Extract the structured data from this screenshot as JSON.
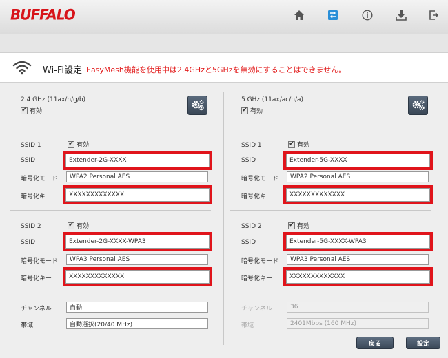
{
  "brand": {
    "logo": "BUFFALO",
    "color": "#d7141a"
  },
  "nav": {
    "icons": [
      "home-icon",
      "network-icon",
      "info-icon",
      "download-icon",
      "logout-icon"
    ],
    "active": "network-icon"
  },
  "header": {
    "title": "Wi-Fi設定",
    "warning": "EasyMesh機能を使用中は2.4GHzと5GHzを無効にすることはできません。"
  },
  "bands": [
    {
      "title": "2.4 GHz (11ax/n/g/b)",
      "enable_label": "有効",
      "ssid1": {
        "label": "SSID 1",
        "enable_label": "有効",
        "ssid_label": "SSID",
        "ssid_value": "Extender-2G-XXXX",
        "mode_label": "暗号化モード",
        "mode_value": "WPA2 Personal AES",
        "key_label": "暗号化キー",
        "key_value": "XXXXXXXXXXXXX"
      },
      "ssid2": {
        "label": "SSID 2",
        "enable_label": "有効",
        "ssid_label": "SSID",
        "ssid_value": "Extender-2G-XXXX-WPA3",
        "mode_label": "暗号化モード",
        "mode_value": "WPA3 Personal AES",
        "key_label": "暗号化キー",
        "key_value": "XXXXXXXXXXXXX"
      },
      "channel_label": "チャンネル",
      "channel_value": "自動",
      "bandwidth_label": "帯域",
      "bandwidth_value": "自動選択(20/40 MHz)"
    },
    {
      "title": "5 GHz (11ax/ac/n/a)",
      "enable_label": "有効",
      "ssid1": {
        "label": "SSID 1",
        "enable_label": "有効",
        "ssid_label": "SSID",
        "ssid_value": "Extender-5G-XXXX",
        "mode_label": "暗号化モード",
        "mode_value": "WPA2 Personal AES",
        "key_label": "暗号化キー",
        "key_value": "XXXXXXXXXXXXX"
      },
      "ssid2": {
        "label": "SSID 2",
        "enable_label": "有効",
        "ssid_label": "SSID",
        "ssid_value": "Extender-5G-XXXX-WPA3",
        "mode_label": "暗号化モード",
        "mode_value": "WPA3 Personal AES",
        "key_label": "暗号化キー",
        "key_value": "XXXXXXXXXXXXX"
      },
      "channel_label": "チャンネル",
      "channel_value": "36",
      "bandwidth_label": "帯域",
      "bandwidth_value": "2401Mbps (160 MHz)"
    }
  ],
  "buttons": {
    "back": "戻る",
    "apply": "設定"
  },
  "colors": {
    "highlight": "#e0141b",
    "warning": "#e21b1b",
    "button": "#4a5868"
  }
}
